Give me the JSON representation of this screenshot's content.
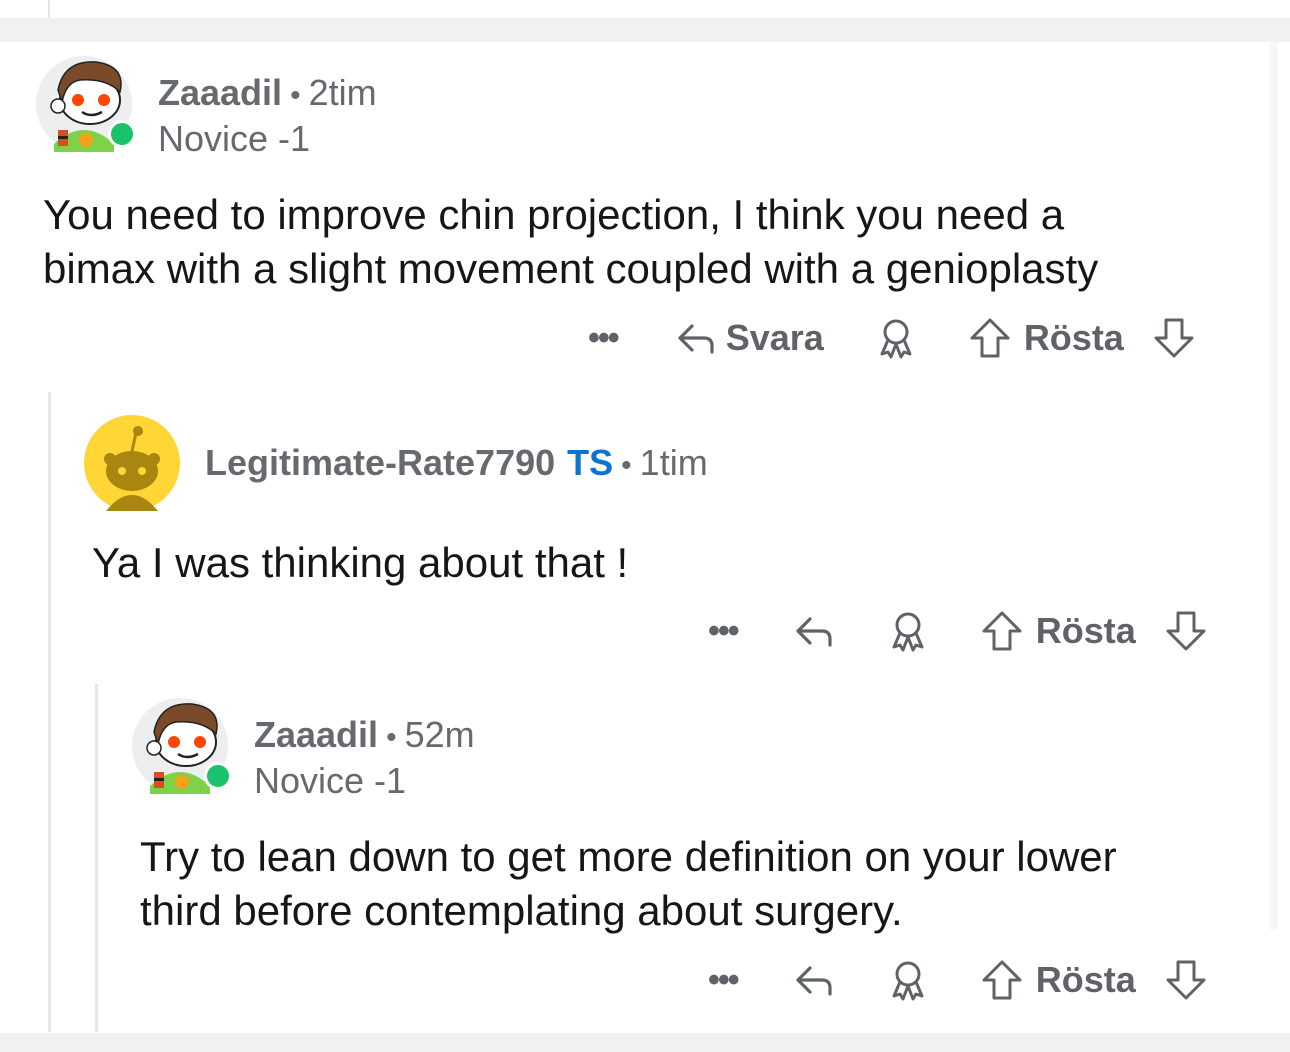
{
  "actions": {
    "reply_label": "Svara",
    "vote_label": "Rösta"
  },
  "comments": [
    {
      "author": "Zaaadil",
      "time": "2tim",
      "flair": "Novice -1",
      "body_line1": "You need to improve chin projection, I think you need a",
      "body_line2": "bimax with a slight movement coupled with a genioplasty"
    },
    {
      "author": "Legitimate-Rate7790",
      "op_badge": "TS",
      "time": "1tim",
      "body_line1": "Ya I was thinking about that !"
    },
    {
      "author": "Zaaadil",
      "time": "52m",
      "flair": "Novice -1",
      "body_line1": "Try to lean down to get more definition on your lower",
      "body_line2": "third before contemplating about surgery."
    }
  ],
  "colors": {
    "online": "#19c26b",
    "op_badge": "#0a74d1",
    "meta": "#666a6e",
    "thread_line": "#e6e7e9"
  },
  "icons": [
    "more-icon",
    "reply-icon",
    "award-icon",
    "upvote-icon",
    "downvote-icon"
  ]
}
